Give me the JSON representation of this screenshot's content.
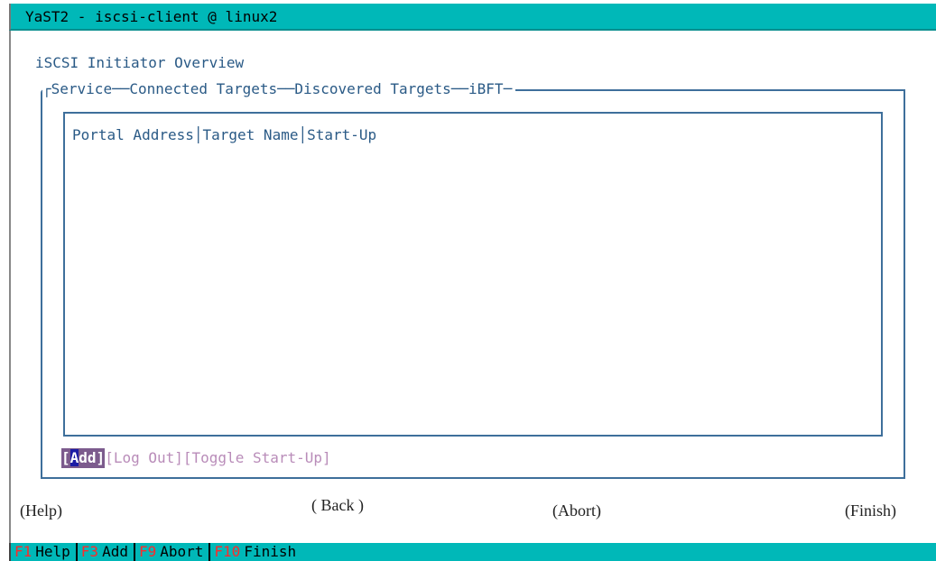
{
  "window": {
    "title": "YaST2 - iscsi-client @ linux2"
  },
  "page": {
    "title": "iSCSI Initiator Overview"
  },
  "tabs": [
    "Service",
    "Connected Targets",
    "Discovered Targets",
    "iBFT"
  ],
  "table": {
    "columns": [
      "Portal Address",
      "Target Name",
      "Start-Up"
    ],
    "rows": []
  },
  "actions": {
    "add_prefix": "[",
    "add_hot": "A",
    "add_rest": "dd]",
    "logout": "[Log Out]",
    "toggle": "[Toggle Start-Up]"
  },
  "nav": {
    "help": "(Help)",
    "back": "( Back )",
    "abort": "(Abort)",
    "finish": "(Finish)"
  },
  "fkeys": [
    {
      "key": "F1",
      "label": "Help"
    },
    {
      "key": "F3",
      "label": "Add"
    },
    {
      "key": "F9",
      "label": "Abort"
    },
    {
      "key": "F10",
      "label": "Finish"
    }
  ],
  "colors": {
    "titlebar": "#00b8b8",
    "frame": "#3e6f9b",
    "text": "#2a5a86",
    "active_button": "#7c5b8d",
    "fkey": "#ff2a2a"
  }
}
